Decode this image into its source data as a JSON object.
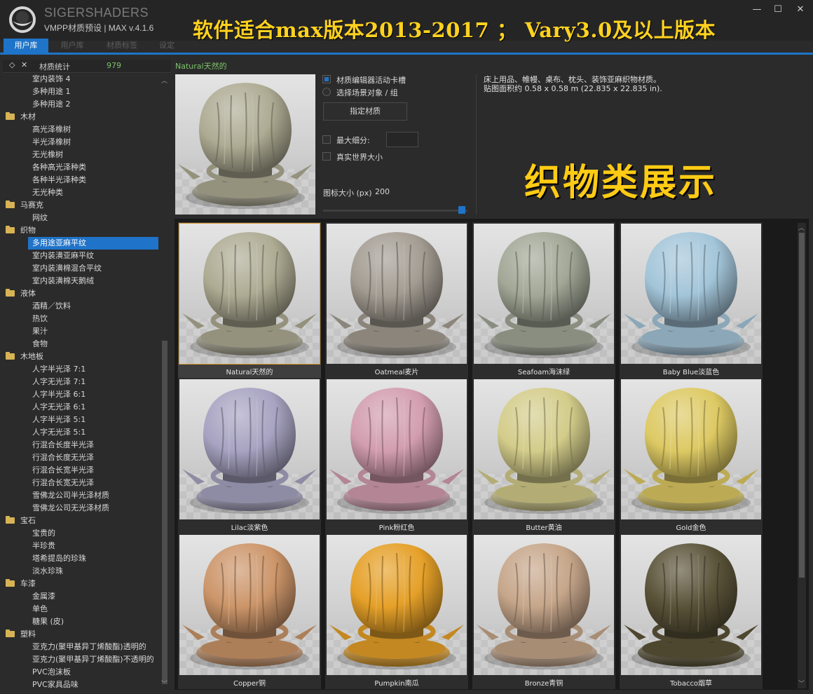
{
  "header": {
    "brand": "SIGERSHADERS",
    "version": "VMPP材质预设 | MAX v.4.1.6",
    "promo": "软件适合max版本2013-2017 ； Vary3.0及以上版本",
    "window_buttons": [
      "—",
      "☐",
      "✕"
    ]
  },
  "tabs": [
    {
      "label": "用户库",
      "active": true
    },
    {
      "label": "用户库",
      "active": false
    },
    {
      "label": "材质标签",
      "active": false
    },
    {
      "label": "设定",
      "active": false
    }
  ],
  "tree_header": {
    "collapse": "◇",
    "close": "✕",
    "label": "材质统计",
    "count": "979"
  },
  "tree": [
    {
      "type": "item",
      "label": "室内装饰 4"
    },
    {
      "type": "item",
      "label": "多种用途 1"
    },
    {
      "type": "item",
      "label": "多种用途 2"
    },
    {
      "type": "folder",
      "label": "木材"
    },
    {
      "type": "item",
      "label": "高光泽橡树"
    },
    {
      "type": "item",
      "label": "半光泽橡树"
    },
    {
      "type": "item",
      "label": "无光橡树"
    },
    {
      "type": "item",
      "label": "各种高光泽种类"
    },
    {
      "type": "item",
      "label": "各种半光泽种类"
    },
    {
      "type": "item",
      "label": "无光种类"
    },
    {
      "type": "folder",
      "label": "马赛克"
    },
    {
      "type": "item",
      "label": "网纹"
    },
    {
      "type": "folder",
      "label": "织物"
    },
    {
      "type": "item",
      "label": "多用途亚麻平纹",
      "selected": true
    },
    {
      "type": "item",
      "label": "室内装潢亚麻平纹"
    },
    {
      "type": "item",
      "label": "室内装潢棉混合平纹"
    },
    {
      "type": "item",
      "label": "室内装潢棉天鹅绒"
    },
    {
      "type": "folder",
      "label": "液体"
    },
    {
      "type": "item",
      "label": "酒精／饮料"
    },
    {
      "type": "item",
      "label": "热饮"
    },
    {
      "type": "item",
      "label": "果汁"
    },
    {
      "type": "item",
      "label": "食物"
    },
    {
      "type": "folder",
      "label": "木地板"
    },
    {
      "type": "item",
      "label": "人字半光泽 7:1"
    },
    {
      "type": "item",
      "label": "人字无光泽 7:1"
    },
    {
      "type": "item",
      "label": "人字半光泽 6:1"
    },
    {
      "type": "item",
      "label": "人字无光泽 6:1"
    },
    {
      "type": "item",
      "label": "人字半光泽 5:1"
    },
    {
      "type": "item",
      "label": "人字无光泽 5:1"
    },
    {
      "type": "item",
      "label": "行混合长度半光泽"
    },
    {
      "type": "item",
      "label": "行混合长度无光泽"
    },
    {
      "type": "item",
      "label": "行混合长宽半光泽"
    },
    {
      "type": "item",
      "label": "行混合长宽无光泽"
    },
    {
      "type": "item",
      "label": "雪佛龙公司半光泽材质"
    },
    {
      "type": "item",
      "label": "雪佛龙公司无光泽材质"
    },
    {
      "type": "folder",
      "label": "宝石"
    },
    {
      "type": "item",
      "label": "宝贵的"
    },
    {
      "type": "item",
      "label": "半珍贵"
    },
    {
      "type": "item",
      "label": "塔希提岛的珍珠"
    },
    {
      "type": "item",
      "label": "淡水珍珠"
    },
    {
      "type": "folder",
      "label": "车漆"
    },
    {
      "type": "item",
      "label": "金属漆"
    },
    {
      "type": "item",
      "label": "单色"
    },
    {
      "type": "item",
      "label": "糖果 (皮)"
    },
    {
      "type": "folder",
      "label": "塑料"
    },
    {
      "type": "item",
      "label": "亚克力(聚甲基异丁烯酸酯)透明的"
    },
    {
      "type": "item",
      "label": "亚克力(聚甲基异丁烯酸酯)不透明的"
    },
    {
      "type": "item",
      "label": "PVC泡沫板"
    },
    {
      "type": "item",
      "label": "PVC家具品味"
    }
  ],
  "selected_material": {
    "name": "Natural天然的",
    "color": "#aeab93"
  },
  "options": {
    "editor_slot": "材质编辑器活动卡槽",
    "editor_slot_checked": true,
    "scene_objects": "选择场景对象 / 组",
    "assign_button": "指定材质",
    "max_subdiv": "最大细分:",
    "real_world": "真实世界大小",
    "icon_size_label": "图标大小 (px)",
    "icon_size_value": "200",
    "icon_size_fraction": 0.97
  },
  "description": {
    "line1": "床上用品、帷幔、桌布、枕头、装饰亚麻织物材质。",
    "line2": "贴图面积约 0.58 x 0.58 m (22.835 x 22.835 in)."
  },
  "showcase": "织物类展示",
  "materials": [
    {
      "name": "Natural天然的",
      "color": "#aeab93",
      "selected": true
    },
    {
      "name": "Oatmeal麦片",
      "color": "#a39c92"
    },
    {
      "name": "Seafoam海沫绿",
      "color": "#a2a796"
    },
    {
      "name": "Baby Blue淡蓝色",
      "color": "#a3c5d9"
    },
    {
      "name": "Lilac淡紫色",
      "color": "#a7a3c1"
    },
    {
      "name": "Pink粉红色",
      "color": "#d29daf"
    },
    {
      "name": "Butter黄油",
      "color": "#d3cc8a"
    },
    {
      "name": "Gold金色",
      "color": "#ddc963"
    },
    {
      "name": "Copper铜",
      "color": "#cc9569"
    },
    {
      "name": "Pumpkin南瓜",
      "color": "#e5a028"
    },
    {
      "name": "Bronze青铜",
      "color": "#c6a68a"
    },
    {
      "name": "Tobacco烟草",
      "color": "#5a5339"
    }
  ]
}
